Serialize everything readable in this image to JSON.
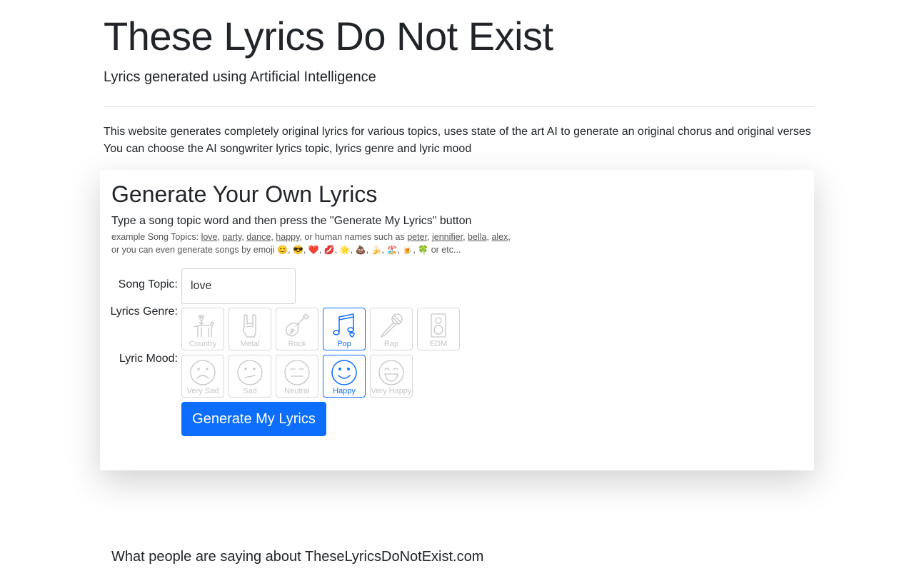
{
  "header": {
    "title": "These Lyrics Do Not Exist",
    "subtitle": "Lyrics generated using Artificial Intelligence"
  },
  "intro": {
    "line1": "This website generates completely original lyrics for various topics, uses state of the art AI to generate an original chorus and original verses",
    "line2": "You can choose the AI songwriter lyrics topic, lyrics genre and lyric mood"
  },
  "generator": {
    "title": "Generate Your Own Lyrics",
    "instruction": "Type a song topic word and then press the \"Generate My Lyrics\" button",
    "examples_prefix": "example Song Topics:",
    "example_topics": [
      "love",
      "party",
      "dance",
      "happy"
    ],
    "names_prefix": "or human names such as",
    "example_names": [
      "peter",
      "jennifier",
      "bella",
      "alex"
    ],
    "emoji_prefix": "or you can even generate songs by emoji",
    "emojis": [
      "😊",
      "😎",
      "❤️",
      "💋",
      "🌟",
      "💩",
      "🍌",
      "🏖️",
      "🍺",
      "🍀"
    ],
    "emoji_suffix": "or etc...",
    "topic_label": "Song Topic:",
    "topic_value": "love",
    "genre_label": "Lyrics Genre:",
    "genres": [
      {
        "label": "Country",
        "icon": "cowboy-horse-icon",
        "selected": false
      },
      {
        "label": "Metal",
        "icon": "rock-hand-icon",
        "selected": false
      },
      {
        "label": "Rock",
        "icon": "guitar-icon",
        "selected": false
      },
      {
        "label": "Pop",
        "icon": "music-note-icon",
        "selected": true
      },
      {
        "label": "Rap",
        "icon": "microphone-icon",
        "selected": false
      },
      {
        "label": "EDM",
        "icon": "speaker-icon",
        "selected": false
      }
    ],
    "mood_label": "Lyric Mood:",
    "moods": [
      {
        "label": "Very Sad",
        "icon": "very-sad-face-icon",
        "selected": false
      },
      {
        "label": "Sad",
        "icon": "sad-face-icon",
        "selected": false
      },
      {
        "label": "Neutral",
        "icon": "neutral-face-icon",
        "selected": false
      },
      {
        "label": "Happy",
        "icon": "happy-face-icon",
        "selected": true
      },
      {
        "label": "Very Happy",
        "icon": "very-happy-face-icon",
        "selected": false
      }
    ],
    "button_label": "Generate My Lyrics"
  },
  "testimonials": {
    "heading": "What people are saying about TheseLyricsDoNotExist.com"
  },
  "colors": {
    "accent": "#0d6efd",
    "text": "#212529",
    "muted_icon": "#c5c5c5"
  }
}
